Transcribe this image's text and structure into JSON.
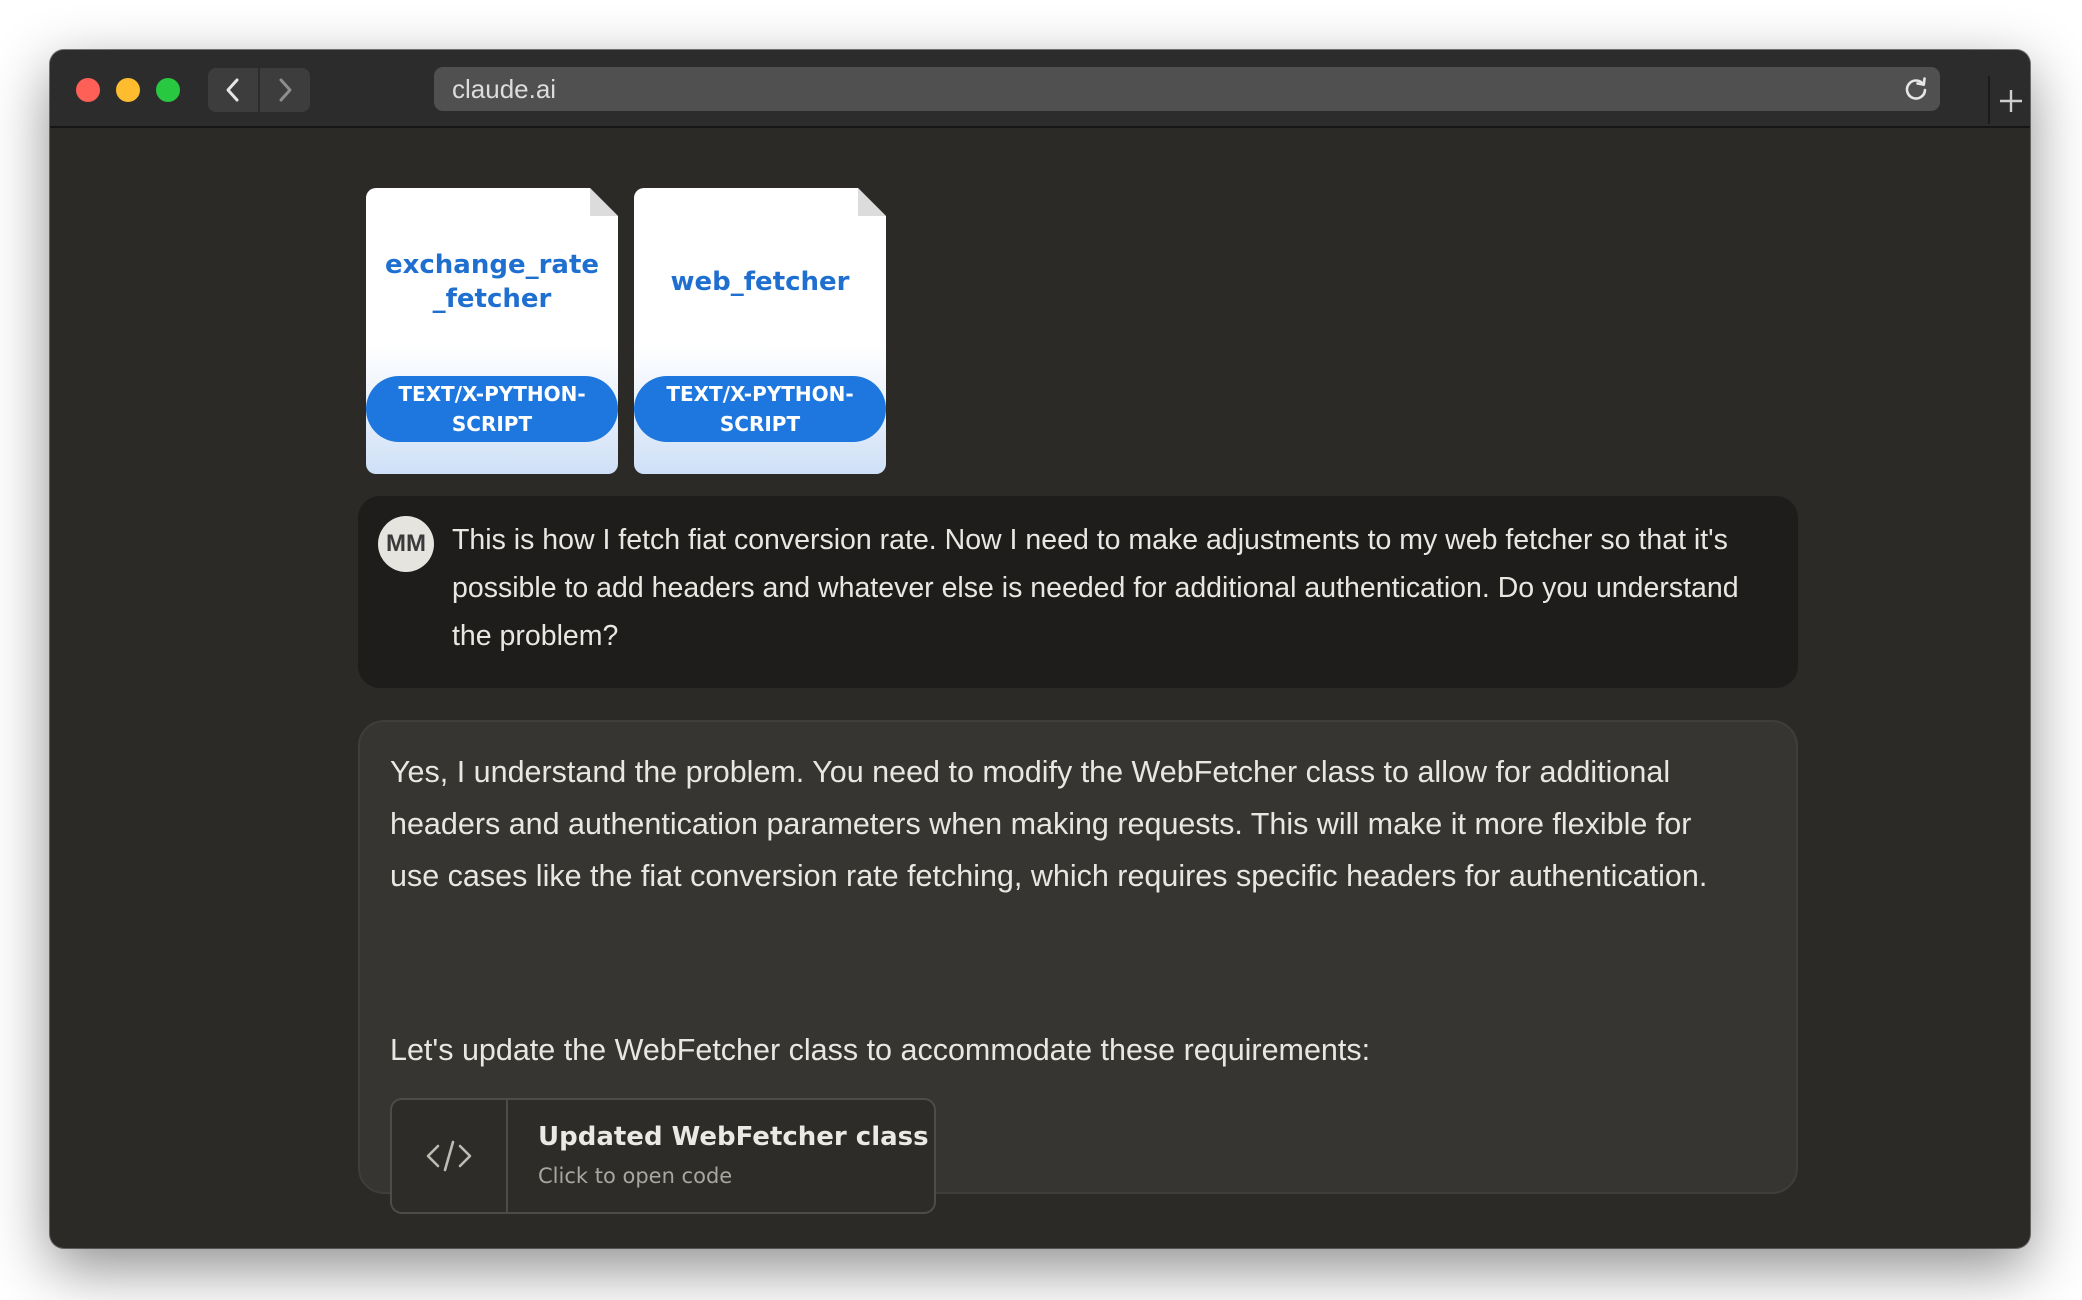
{
  "browser": {
    "url": "claude.ai"
  },
  "attachments": [
    {
      "name": "exchange_rate\n_fetcher",
      "type": "TEXT/X-PYTHON-SCRIPT"
    },
    {
      "name": "web_fetcher",
      "type": "TEXT/X-PYTHON-SCRIPT"
    }
  ],
  "user_message": {
    "avatar_initials": "MM",
    "text": "This is how I fetch fiat conversion rate. Now I need to make adjustments to my web fetcher so that it's possible to add headers and whatever else is needed for additional authentication. Do you understand the problem?"
  },
  "assistant_message": {
    "paragraph_1": "Yes, I understand the problem. You need to modify the WebFetcher class to allow for additional headers and authentication parameters when making requests. This will make it more flexible for use cases like the fiat conversion rate fetching, which requires specific headers for authentication.",
    "paragraph_2": "Let's update the WebFetcher class to accommodate these requirements:",
    "artifact": {
      "title": "Updated WebFetcher class",
      "subtitle": "Click to open code",
      "icon": "code-icon"
    }
  },
  "colors": {
    "accent_blue": "#1e77de",
    "window_bg": "#2b2a27",
    "user_bubble": "#1e1d1b",
    "assistant_bubble": "#363531"
  }
}
